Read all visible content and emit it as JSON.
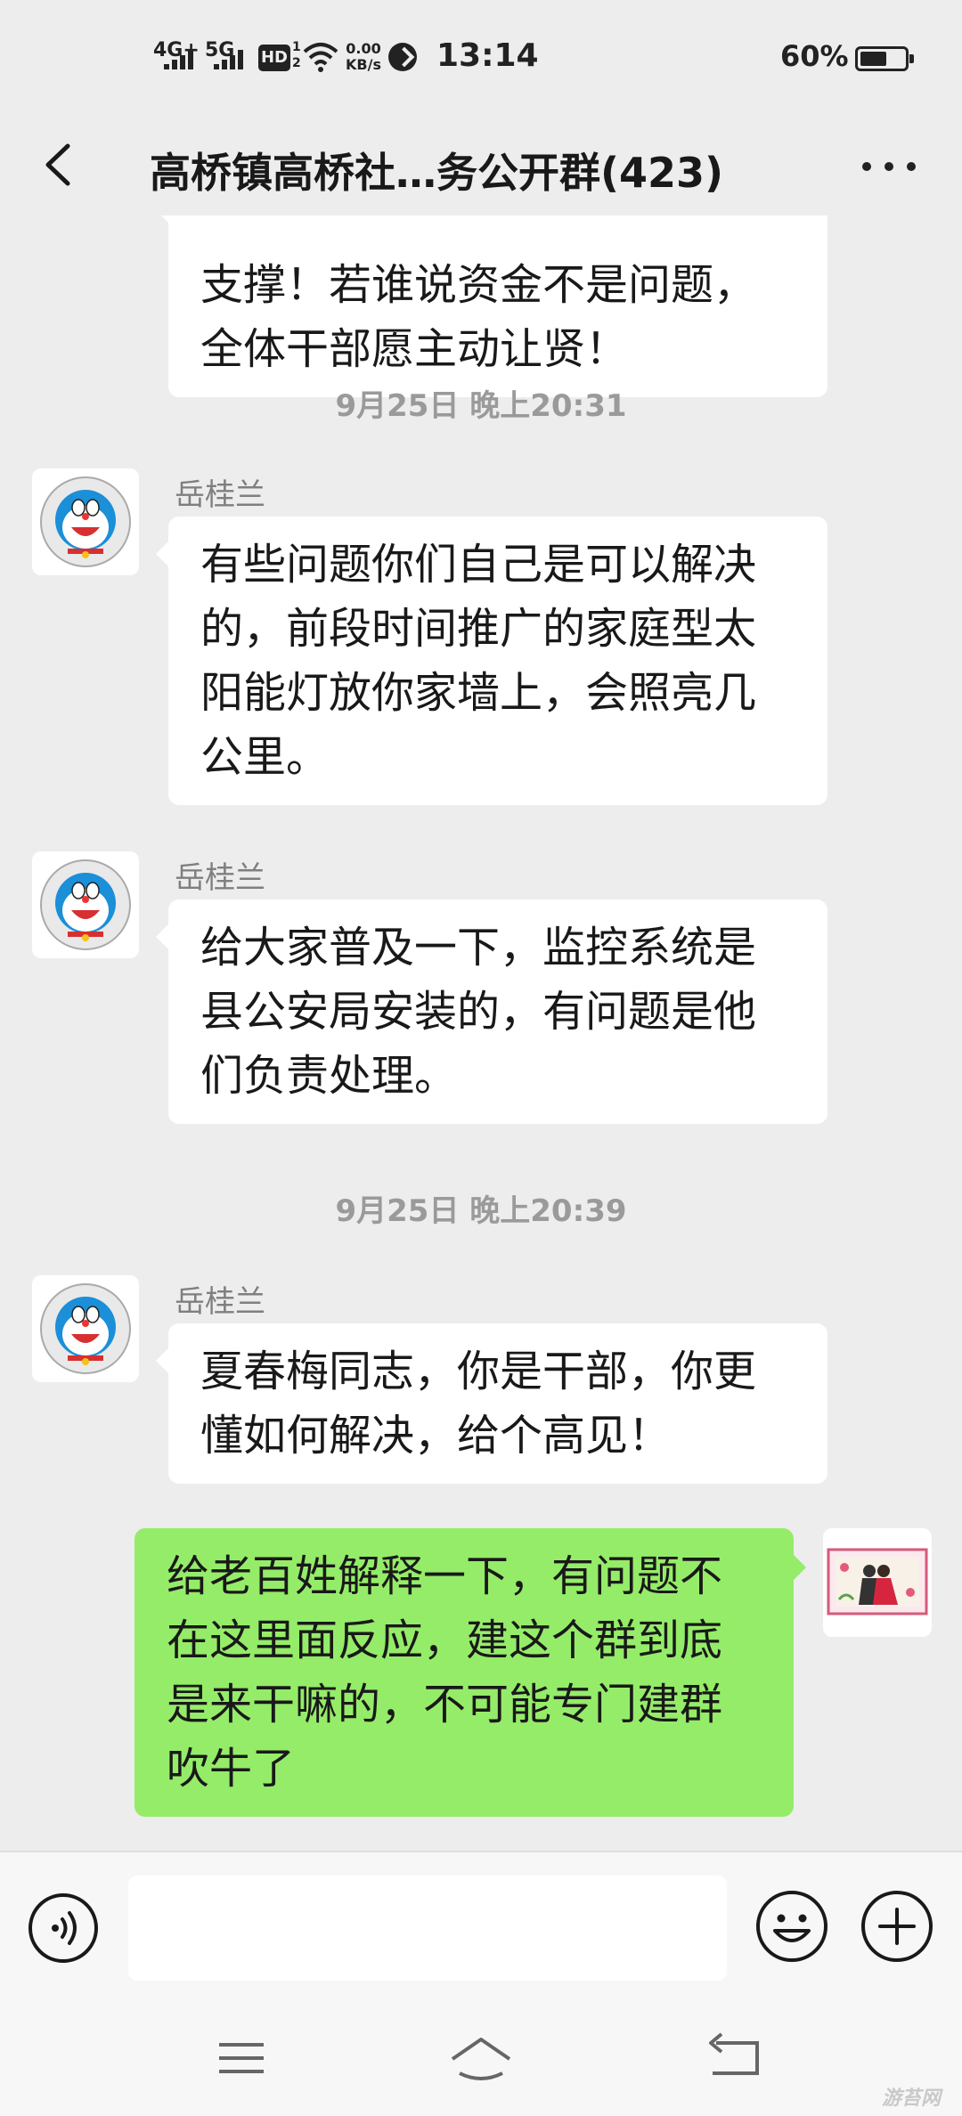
{
  "status_bar": {
    "network_1": "4G+",
    "network_2": "5G",
    "hd_badge": "HD",
    "hd_sub": "1\n2",
    "speed": "0.00\nKB/s",
    "time": "13:14",
    "battery_text": "60%",
    "battery_level": 0.6
  },
  "header": {
    "title": "高桥镇高桥社…务公开群(423)"
  },
  "messages": [
    {
      "type": "text",
      "side": "left",
      "text": "支撑！若谁说资金不是问题，\n全体干部愿主动让贤！"
    },
    {
      "type": "time",
      "text": "9月25日 晚上20:31"
    },
    {
      "type": "text",
      "side": "left",
      "sender": "岳桂兰",
      "text": "有些问题你们自己是可以解决的，前段时间推广的家庭型太阳能灯放你家墙上，会照亮几公里。"
    },
    {
      "type": "text",
      "side": "left",
      "sender": "岳桂兰",
      "text": "给大家普及一下，监控系统是县公安局安装的，有问题是他们负责处理。"
    },
    {
      "type": "time",
      "text": "9月25日 晚上20:39"
    },
    {
      "type": "text",
      "side": "left",
      "sender": "岳桂兰",
      "text": "夏春梅同志，你是干部，你更懂如何解决，给个高见！"
    },
    {
      "type": "text",
      "side": "right",
      "text": "给老百姓解释一下，有问题不在这里面反应，建这个群到底是来干嘛的，不可能专门建群吹牛了"
    }
  ],
  "icons": {
    "back": "chevron-left-icon",
    "more": "more-dots-icon",
    "voice": "voice-icon",
    "emoji": "emoji-icon",
    "add": "plus-icon",
    "sys_menu": "menu-icon",
    "sys_home": "home-icon",
    "sys_back": "back-icon"
  },
  "colors": {
    "background": "#ededed",
    "my_bubble": "#95ec69",
    "other_bubble": "#ffffff",
    "sender_text": "#7f7f7f"
  },
  "watermark": "游苔网"
}
